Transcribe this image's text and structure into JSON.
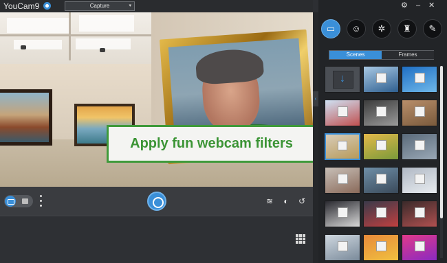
{
  "titlebar": {
    "brand": "YouCam9",
    "brand_icon": "camera-badge-icon"
  },
  "mode_select": {
    "value": "Capture",
    "caret": "▾"
  },
  "window_controls": {
    "settings": "⚙",
    "minimize": "–",
    "close": "✕"
  },
  "banner": {
    "text": "Apply fun webcam filters",
    "border_color": "#3f9a3a",
    "text_color": "#3b9435"
  },
  "controls": {
    "shutter_icon": "aperture-icon",
    "layers_glyph": "≋",
    "effects_glyph": "◐",
    "rotate_glyph": "↺"
  },
  "side_panel": {
    "categories": [
      {
        "name": "scenes-category",
        "glyph": "▭",
        "active": true
      },
      {
        "name": "emoji-category",
        "glyph": "☺",
        "active": false
      },
      {
        "name": "particles-category",
        "glyph": "✲",
        "active": false
      },
      {
        "name": "avatar-category",
        "glyph": "♜",
        "active": false
      },
      {
        "name": "brush-category",
        "glyph": "✎",
        "active": false
      }
    ],
    "tabs": {
      "scenes": "Scenes",
      "frames": "Frames"
    },
    "download_glyph": "↓",
    "thumbnails": [
      {
        "kind": "download",
        "colors": [
          "#4b4f55",
          "#4b4f55"
        ]
      },
      {
        "kind": "scene",
        "colors": [
          "#a9c9e4",
          "#2f5f8f"
        ]
      },
      {
        "kind": "scene",
        "colors": [
          "#1f6fc3",
          "#6fb8ea"
        ]
      },
      {
        "kind": "scene",
        "colors": [
          "#cfe2f4",
          "#c05050"
        ]
      },
      {
        "kind": "scene",
        "colors": [
          "#3c3c3c",
          "#9a9a9a"
        ]
      },
      {
        "kind": "scene",
        "colors": [
          "#b88e6a",
          "#7a5a3c"
        ]
      },
      {
        "kind": "scene",
        "colors": [
          "#d8ccb8",
          "#b79a5a"
        ],
        "selected": true
      },
      {
        "kind": "scene",
        "colors": [
          "#e4b94a",
          "#7a9a3a"
        ]
      },
      {
        "kind": "scene",
        "colors": [
          "#5a6a7a",
          "#9aa8b6"
        ]
      },
      {
        "kind": "scene",
        "colors": [
          "#c8c0b8",
          "#8a6a5a"
        ]
      },
      {
        "kind": "scene",
        "colors": [
          "#6f8fa8",
          "#3a4a5a"
        ]
      },
      {
        "kind": "scene",
        "colors": [
          "#b0b8c4",
          "#e8ecf0"
        ]
      },
      {
        "kind": "scene",
        "colors": [
          "#2a2a30",
          "#d8d8d8"
        ]
      },
      {
        "kind": "scene",
        "colors": [
          "#3a3a4a",
          "#c04040"
        ]
      },
      {
        "kind": "scene",
        "colors": [
          "#3a2a2a",
          "#b05050"
        ]
      },
      {
        "kind": "scene",
        "colors": [
          "#cfd8e0",
          "#7a8a9a"
        ]
      },
      {
        "kind": "scene",
        "colors": [
          "#e88a3a",
          "#f0c040"
        ]
      },
      {
        "kind": "scene",
        "colors": [
          "#e03a8a",
          "#8a2ac0"
        ]
      }
    ]
  }
}
